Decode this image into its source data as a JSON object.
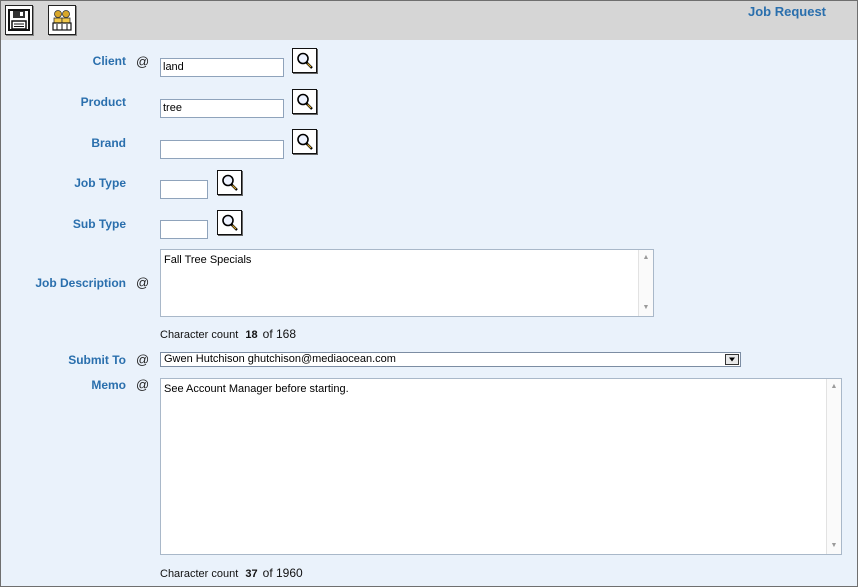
{
  "toolbar": {
    "title": "Job Request",
    "save_icon": "save-icon",
    "people_icon": "people-icon"
  },
  "form": {
    "client": {
      "label": "Client",
      "marker": "@",
      "value": "land"
    },
    "product": {
      "label": "Product",
      "value": "tree"
    },
    "brand": {
      "label": "Brand",
      "value": ""
    },
    "job_type": {
      "label": "Job Type",
      "value": ""
    },
    "sub_type": {
      "label": "Sub Type",
      "value": ""
    },
    "job_description": {
      "label": "Job Description",
      "marker": "@",
      "value": "Fall Tree Specials",
      "count_label": "Character count",
      "count": "18",
      "count_max": "of 168"
    },
    "submit_to": {
      "label": "Submit To",
      "marker": "@",
      "value": "Gwen Hutchison  ghutchison@mediaocean.com"
    },
    "memo": {
      "label": "Memo",
      "marker": "@",
      "value": "See Account Manager before starting.",
      "count_label": "Character count",
      "count": "37",
      "count_max": "of 1960"
    }
  },
  "icons": {
    "lookup": "magnifier-icon",
    "select_arrow": "chevron-down-icon"
  }
}
